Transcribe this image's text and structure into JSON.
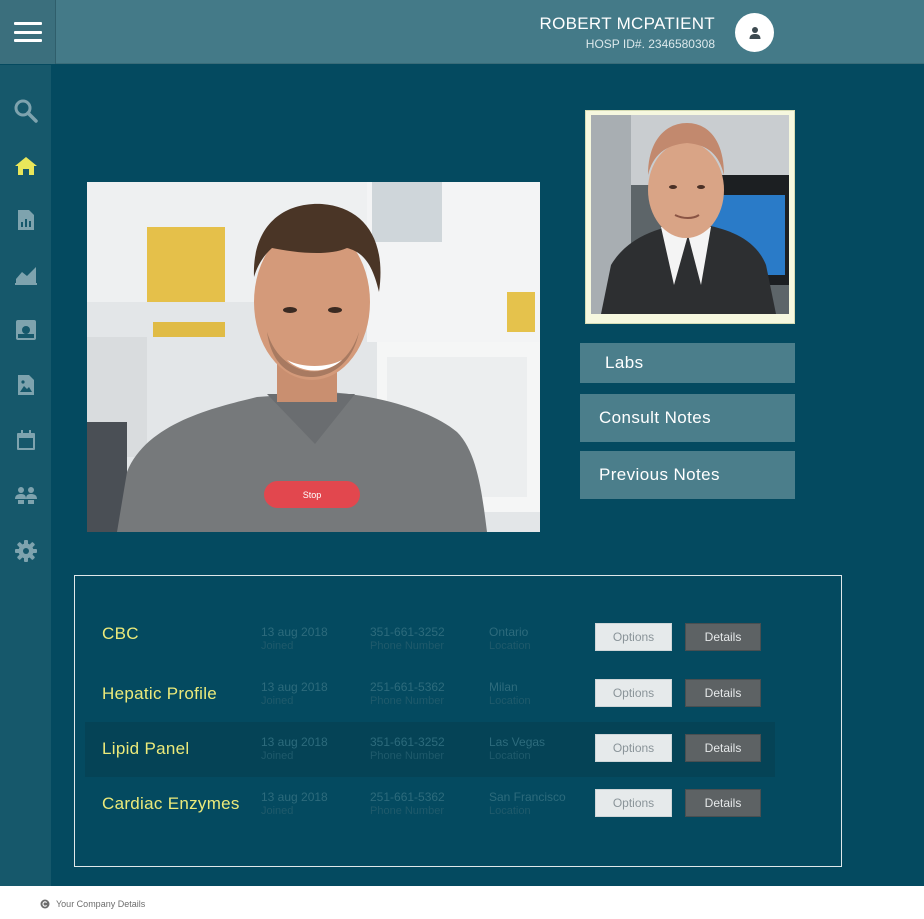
{
  "header": {
    "patient_name": "ROBERT MCPATIENT",
    "hosp_id": "HOSP ID#. 2346580308",
    "avatar_icon": "user-icon",
    "menu_icon": "hamburger-menu-icon"
  },
  "sidebar": {
    "items": [
      {
        "icon": "search-icon",
        "active": false
      },
      {
        "icon": "home-icon",
        "active": true
      },
      {
        "icon": "report-icon",
        "active": false
      },
      {
        "icon": "chart-icon",
        "active": false
      },
      {
        "icon": "monitor-icon",
        "active": false
      },
      {
        "icon": "image-icon",
        "active": false
      },
      {
        "icon": "calendar-icon",
        "active": false
      },
      {
        "icon": "people-icon",
        "active": false
      },
      {
        "icon": "gear-icon",
        "active": false
      }
    ]
  },
  "video": {
    "stop_label": "Stop"
  },
  "side_buttons": {
    "labs": "Labs",
    "consult_notes": "Consult Notes",
    "previous_notes": "Previous Notes"
  },
  "results": {
    "rows": [
      {
        "title": "CBC",
        "date": "13 aug 2018",
        "date_label": "Joined",
        "phone": "351-661-3252",
        "phone_label": "Phone Number",
        "location": "Ontario",
        "location_label": "Location",
        "options": "Options",
        "details": "Details"
      },
      {
        "title": "Hepatic Profile",
        "date": "13 aug 2018",
        "date_label": "Joined",
        "phone": "251-661-5362",
        "phone_label": "Phone Number",
        "location": "Milan",
        "location_label": "Location",
        "options": "Options",
        "details": "Details"
      },
      {
        "title": "Lipid Panel",
        "date": "13 aug 2018",
        "date_label": "Joined",
        "phone": "351-661-3252",
        "phone_label": "Phone Number",
        "location": "Las Vegas",
        "location_label": "Location",
        "options": "Options",
        "details": "Details"
      },
      {
        "title": "Cardiac Enzymes",
        "date": "13 aug 2018",
        "date_label": "Joined",
        "phone": "251-661-5362",
        "phone_label": "Phone Number",
        "location": "San Francisco",
        "location_label": "Location",
        "options": "Options",
        "details": "Details"
      }
    ]
  },
  "footer": {
    "text": "Your Company Details",
    "icon": "copyright-icon"
  },
  "colors": {
    "background": "#044a60",
    "header": "#447a88",
    "sidebar": "#16586b",
    "accent_yellow": "#ecea7a",
    "stop_red": "#e2474e",
    "side_button": "#4b7e8b"
  }
}
